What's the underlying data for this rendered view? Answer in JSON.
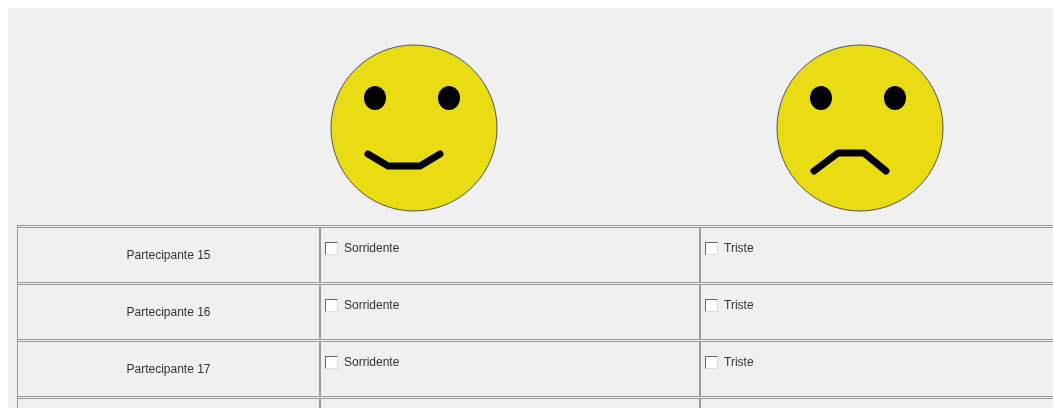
{
  "faces": [
    {
      "kind": "happy"
    },
    {
      "kind": "sad"
    }
  ],
  "rows": [
    {
      "participant": "Partecipante 15",
      "options": [
        {
          "label": "Sorridente",
          "checked": false
        },
        {
          "label": "Triste",
          "checked": false
        }
      ]
    },
    {
      "participant": "Partecipante 16",
      "options": [
        {
          "label": "Sorridente",
          "checked": false
        },
        {
          "label": "Triste",
          "checked": false
        }
      ]
    },
    {
      "participant": "Partecipante 17",
      "options": [
        {
          "label": "Sorridente",
          "checked": false
        },
        {
          "label": "Triste",
          "checked": false
        }
      ]
    }
  ]
}
